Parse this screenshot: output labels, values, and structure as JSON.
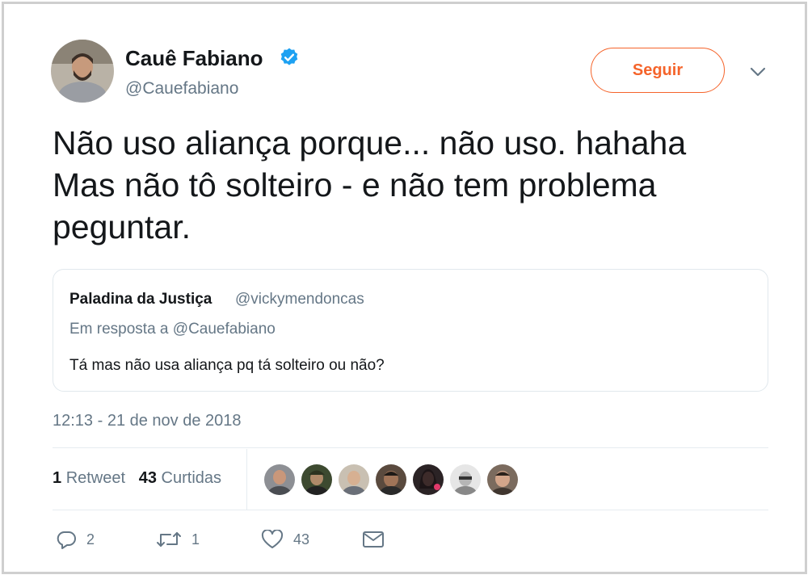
{
  "author": {
    "name": "Cauê Fabiano",
    "handle": "@Cauefabiano",
    "verified_icon": "verified-badge-icon",
    "colors": {
      "verified": "#1da1f2"
    }
  },
  "header": {
    "follow_label": "Seguir",
    "follow_color": "#f5642b",
    "menu_icon": "chevron-down-icon"
  },
  "tweet": {
    "lines": [
      "Não uso aliança porque... não uso. hahaha",
      "Mas não tô solteiro - e não tem problema",
      "peguntar."
    ]
  },
  "quoted": {
    "name": "Paladina da Justiça",
    "handle": "@vickymendoncas",
    "reply_prefix": "Em resposta a",
    "reply_to": "@Cauefabiano",
    "text": "Tá mas não usa aliança pq tá solteiro ou não?"
  },
  "timestamp": "12:13 - 21 de nov de 2018",
  "stats": {
    "retweets_count": "1",
    "retweets_label": "Retweet",
    "likes_count": "43",
    "likes_label": "Curtidas"
  },
  "likers_count_shown": 7,
  "actions": {
    "reply": {
      "icon": "reply-icon",
      "count": "2"
    },
    "retweet": {
      "icon": "retweet-icon",
      "count": "1"
    },
    "like": {
      "icon": "heart-icon",
      "count": "43"
    },
    "message": {
      "icon": "envelope-icon"
    }
  }
}
